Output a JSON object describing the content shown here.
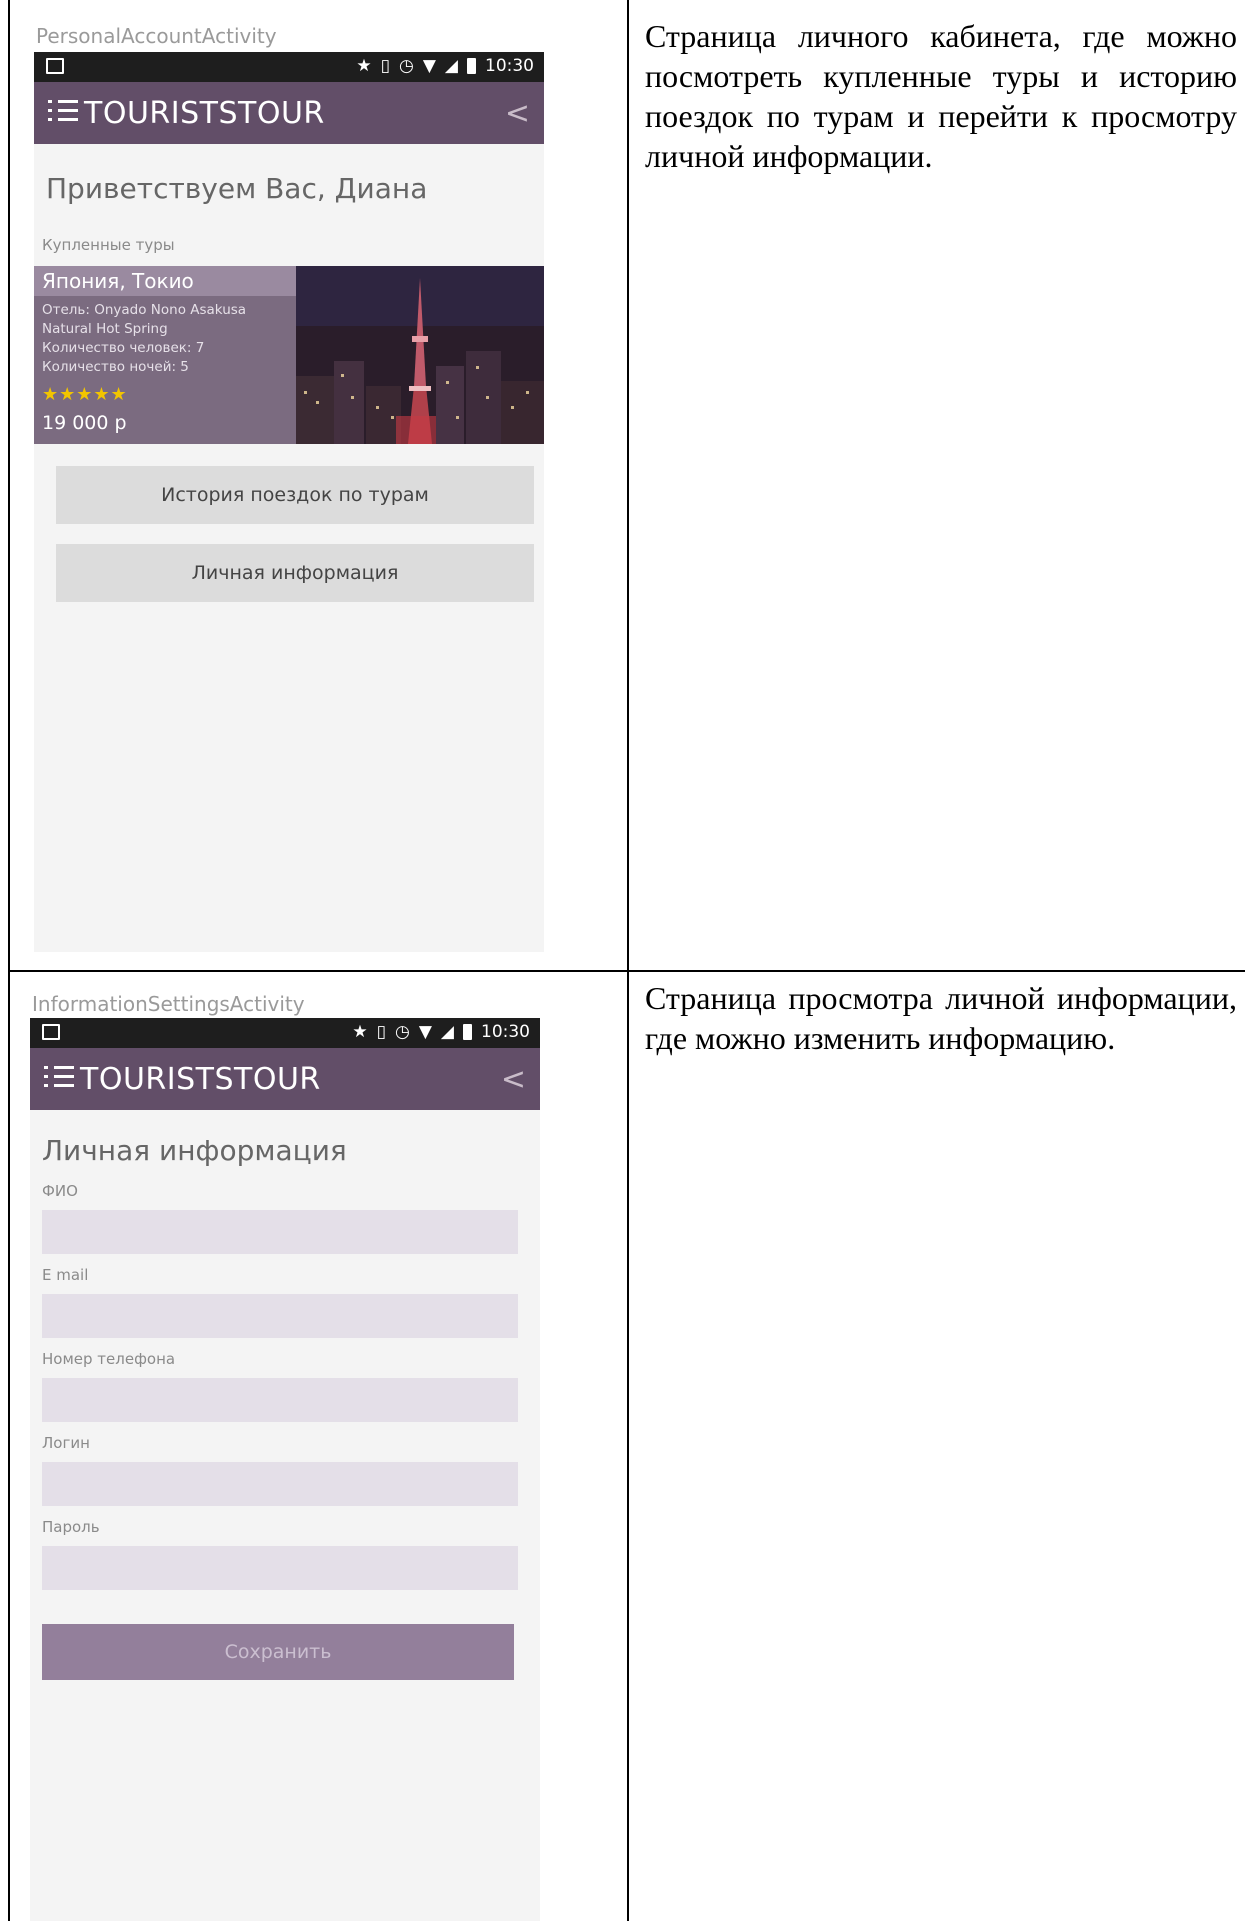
{
  "rows": [
    {
      "activity": "PersonalAccountActivity",
      "status_time": "10:30",
      "app_title": "TOURISTSTOUR",
      "greeting": "Приветствуем Вас, Диана",
      "purchased_label": "Купленные туры",
      "tour": {
        "city": "Япония, Токио",
        "hotel_line1": "Отель: Onyado Nono Asakusa",
        "hotel_line2": "Natural Hot Spring",
        "people": "Количество человек: 7",
        "nights": "Количество ночей: 5",
        "stars": "★★★★★",
        "rating": 5,
        "price": "19 000 р"
      },
      "buttons": [
        "История поездок по турам",
        "Личная информация"
      ],
      "description": "Страница личного кабинета, где можно посмотреть купленные туры и историю поездок по турам и перейти к просмотру личной информации."
    },
    {
      "activity": "InformationSettingsActivity",
      "status_time": "10:30",
      "app_title": "TOURISTSTOUR",
      "screen_title": "Личная информация",
      "fields": [
        {
          "label": "ФИО",
          "value": ""
        },
        {
          "label": "E mail",
          "value": ""
        },
        {
          "label": "Номер телефона",
          "value": ""
        },
        {
          "label": "Логин",
          "value": ""
        },
        {
          "label": "Пароль",
          "value": ""
        }
      ],
      "save_button": "Сохранить",
      "description": "Страница просмотра личной информации, где можно изменить информацию."
    }
  ],
  "colors": {
    "appbar": "#624e68",
    "card_info": "#7b6b80",
    "save_button": "#937f9b",
    "field": "#e4dfe8",
    "stars": "#f2c500"
  },
  "icons": [
    "menu-icon",
    "back-icon",
    "star-icon",
    "vibrate-icon",
    "alarm-icon",
    "wifi-icon",
    "signal-icon",
    "battery-icon",
    "image-notification-icon"
  ]
}
